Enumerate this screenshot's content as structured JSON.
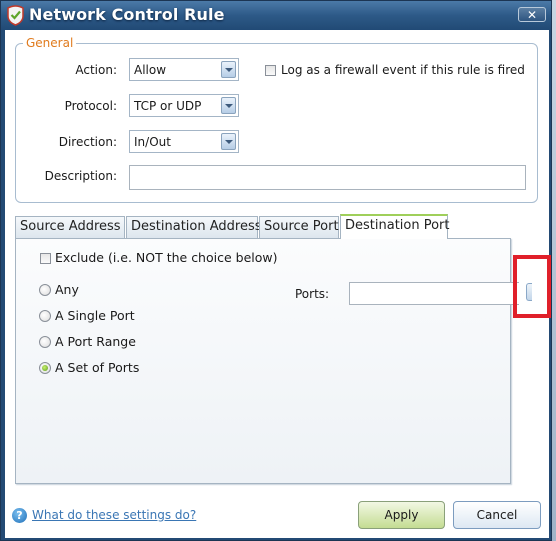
{
  "window": {
    "title": "Network Control Rule",
    "close_label": "✕"
  },
  "general": {
    "legend": "General",
    "action": {
      "label": "Action:",
      "value": "Allow"
    },
    "protocol": {
      "label": "Protocol:",
      "value": "TCP or UDP"
    },
    "direction": {
      "label": "Direction:",
      "value": "In/Out"
    },
    "description": {
      "label": "Description:",
      "value": ""
    },
    "log_checkbox": {
      "label": "Log as a firewall event if this rule is fired",
      "checked": false
    }
  },
  "tabs": [
    {
      "label": "Source Address",
      "active": false
    },
    {
      "label": "Destination Address",
      "active": false
    },
    {
      "label": "Source Port",
      "active": false
    },
    {
      "label": "Destination Port",
      "active": true
    }
  ],
  "destination_port": {
    "exclude": {
      "label": "Exclude (i.e. NOT the choice below)",
      "checked": false
    },
    "options": [
      {
        "label": "Any",
        "checked": false
      },
      {
        "label": "A Single Port",
        "checked": false
      },
      {
        "label": "A Port Range",
        "checked": false
      },
      {
        "label": "A Set of Ports",
        "checked": true
      }
    ],
    "ports": {
      "label": "Ports:",
      "value": ""
    }
  },
  "footer": {
    "help_link": "What do these settings do?",
    "apply_label": "Apply",
    "cancel_label": "Cancel"
  },
  "colors": {
    "group_legend": "#e07b1e",
    "active_tab_accent": "#9fcf5a",
    "annotation": "#e0202a",
    "link": "#3a76b4"
  }
}
